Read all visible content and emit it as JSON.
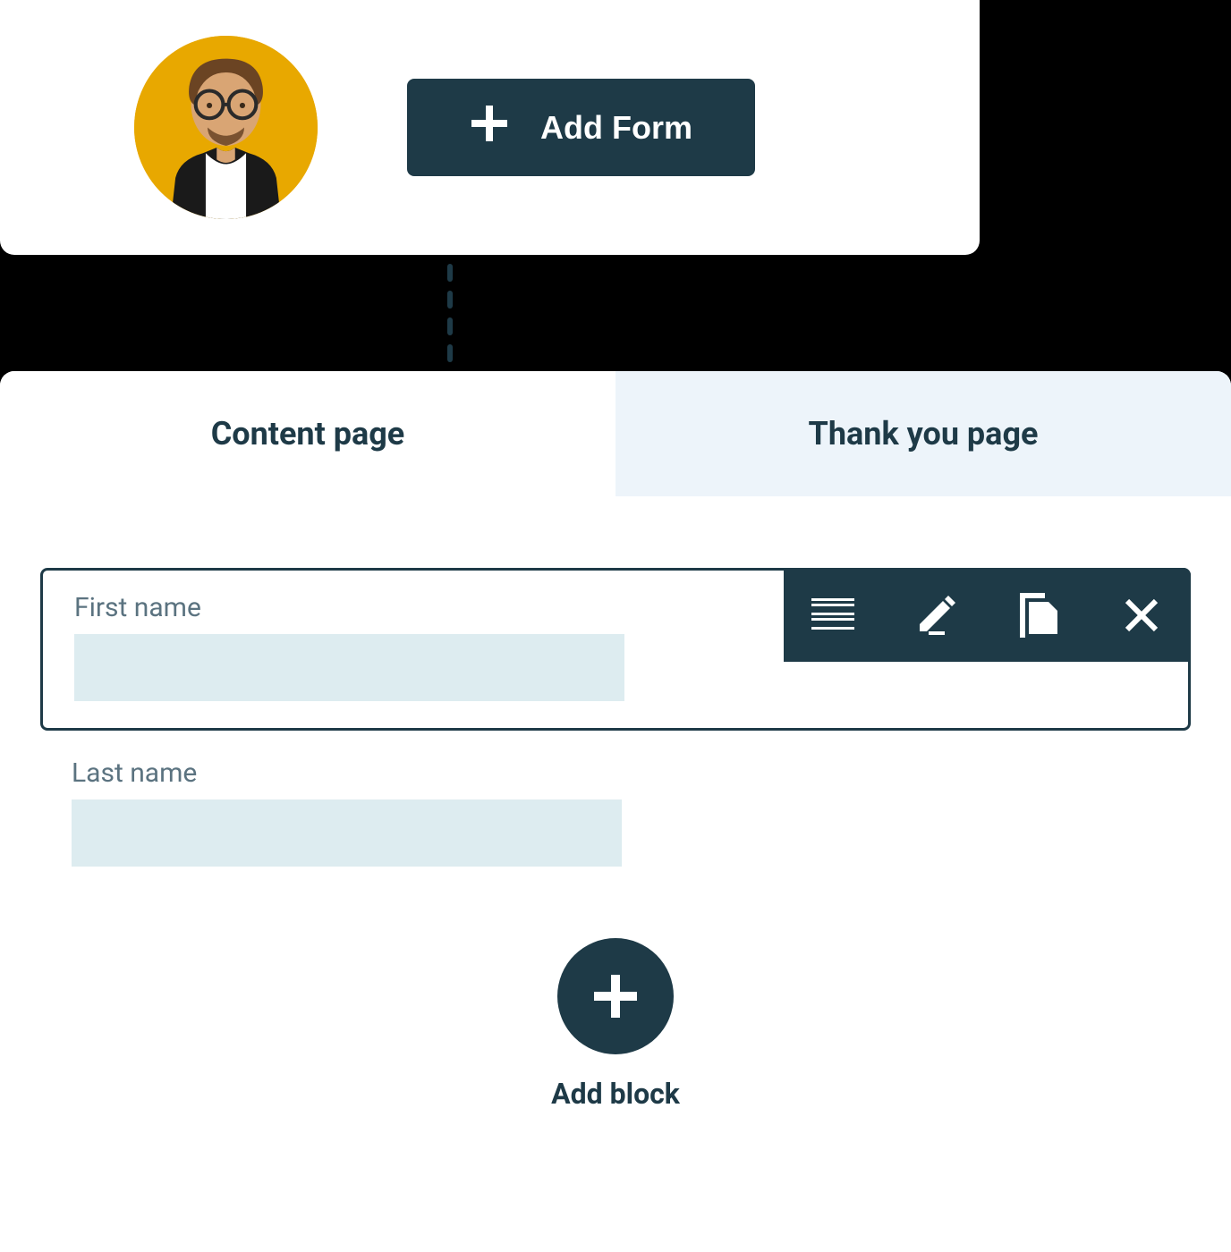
{
  "header": {
    "add_form_label": "Add Form"
  },
  "tabs": [
    {
      "label": "Content page",
      "active": true
    },
    {
      "label": "Thank you page",
      "active": false
    }
  ],
  "fields": [
    {
      "label": "First name",
      "selected": true
    },
    {
      "label": "Last name",
      "selected": false
    }
  ],
  "toolbar": {
    "icons": [
      "menu",
      "edit",
      "copy",
      "close"
    ]
  },
  "add_block": {
    "label": "Add block"
  }
}
